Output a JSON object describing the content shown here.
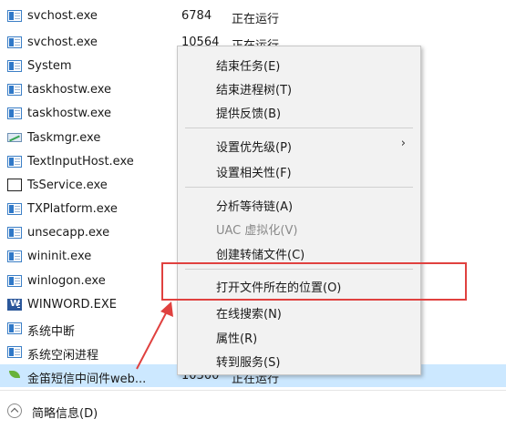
{
  "processes": [
    {
      "name": "svchost.exe",
      "pid": "6784",
      "status": "正在运行",
      "icon": "app-window-icon"
    },
    {
      "name": "svchost.exe",
      "pid": "10564",
      "status": "正在运行",
      "icon": "app-window-icon"
    },
    {
      "name": "System",
      "pid": "",
      "status": "",
      "icon": "app-window-icon"
    },
    {
      "name": "taskhostw.exe",
      "pid": "",
      "status": "",
      "icon": "app-window-icon"
    },
    {
      "name": "taskhostw.exe",
      "pid": "",
      "status": "",
      "icon": "app-window-icon"
    },
    {
      "name": "Taskmgr.exe",
      "pid": "",
      "status": "",
      "icon": "task-manager-icon"
    },
    {
      "name": "TextInputHost.exe",
      "pid": "",
      "status": "",
      "icon": "app-window-icon"
    },
    {
      "name": "TsService.exe",
      "pid": "",
      "status": "",
      "icon": "blank-window-icon"
    },
    {
      "name": "TXPlatform.exe",
      "pid": "",
      "status": "",
      "icon": "app-window-icon"
    },
    {
      "name": "unsecapp.exe",
      "pid": "",
      "status": "",
      "icon": "app-window-icon"
    },
    {
      "name": "wininit.exe",
      "pid": "",
      "status": "",
      "icon": "app-window-icon"
    },
    {
      "name": "winlogon.exe",
      "pid": "",
      "status": "",
      "icon": "app-window-icon"
    },
    {
      "name": "WINWORD.EXE",
      "pid": "",
      "status": "",
      "icon": "word-icon"
    },
    {
      "name": "系统中断",
      "pid": "",
      "status": "",
      "icon": "app-window-icon"
    },
    {
      "name": "系统空闲进程",
      "pid": "",
      "status": "",
      "icon": "app-window-icon"
    },
    {
      "name": "金笛短信中间件web...",
      "pid": "10300",
      "status": "正在运行",
      "icon": "leaf-icon"
    }
  ],
  "context_menu": {
    "items": [
      {
        "label": "结束任务(E)",
        "enabled": true
      },
      {
        "label": "结束进程树(T)",
        "enabled": true
      },
      {
        "label": "提供反馈(B)",
        "enabled": true
      },
      {
        "label": "设置优先级(P)",
        "enabled": true,
        "submenu_arrow": "›"
      },
      {
        "label": "设置相关性(F)",
        "enabled": true
      },
      {
        "label": "分析等待链(A)",
        "enabled": true
      },
      {
        "label": "UAC 虚拟化(V)",
        "enabled": false
      },
      {
        "label": "创建转储文件(C)",
        "enabled": true
      },
      {
        "label": "打开文件所在的位置(O)",
        "enabled": true
      },
      {
        "label": "在线搜索(N)",
        "enabled": true
      },
      {
        "label": "属性(R)",
        "enabled": true
      },
      {
        "label": "转到服务(S)",
        "enabled": true
      }
    ]
  },
  "footer": {
    "details_label": "简略信息(D)"
  },
  "annotation": {
    "color": "#e0413f"
  },
  "colors": {
    "selected_row": "#cce8ff",
    "menu_bg": "#f2f2f2"
  }
}
